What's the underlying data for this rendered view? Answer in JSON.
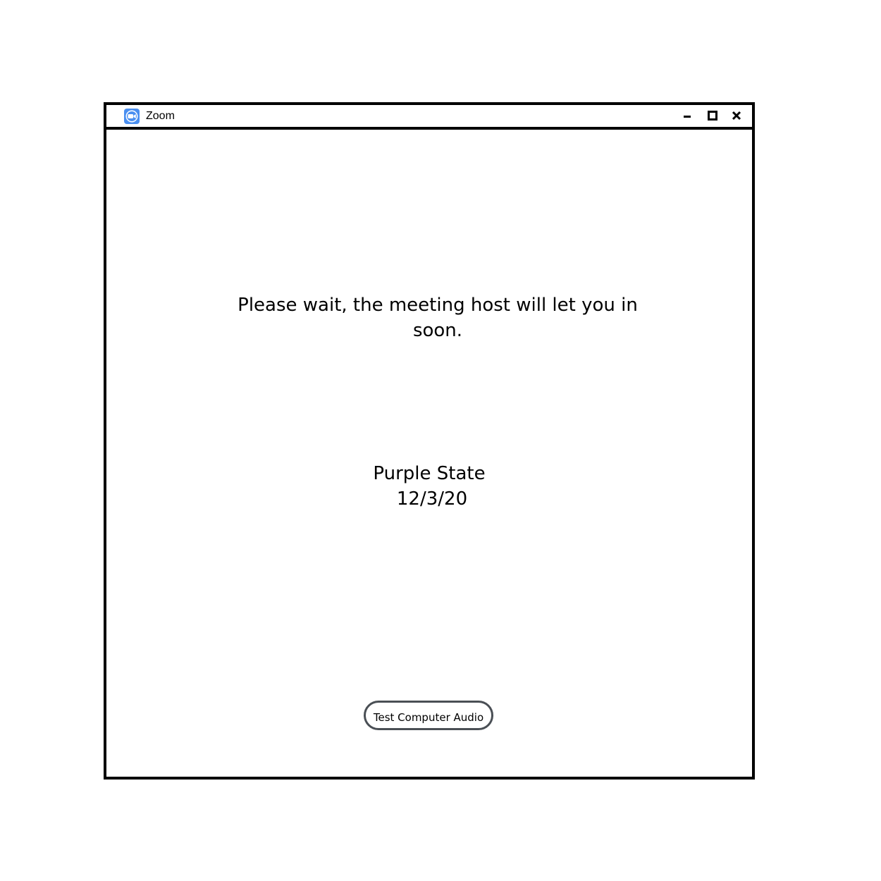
{
  "window": {
    "title": "Zoom",
    "app_icon": "zoom-camera-icon",
    "controls": {
      "minimize_icon": "minimize-icon",
      "maximize_icon": "maximize-icon",
      "close_icon": "close-icon"
    }
  },
  "waiting_room": {
    "message": "Please wait, the meeting host will let you in soon.",
    "meeting_name": "Purple State",
    "meeting_date": "12/3/20",
    "test_audio_label": "Test Computer Audio"
  },
  "colors": {
    "zoom_blue": "#4a8ff0",
    "button_border": "#4a4f55"
  }
}
